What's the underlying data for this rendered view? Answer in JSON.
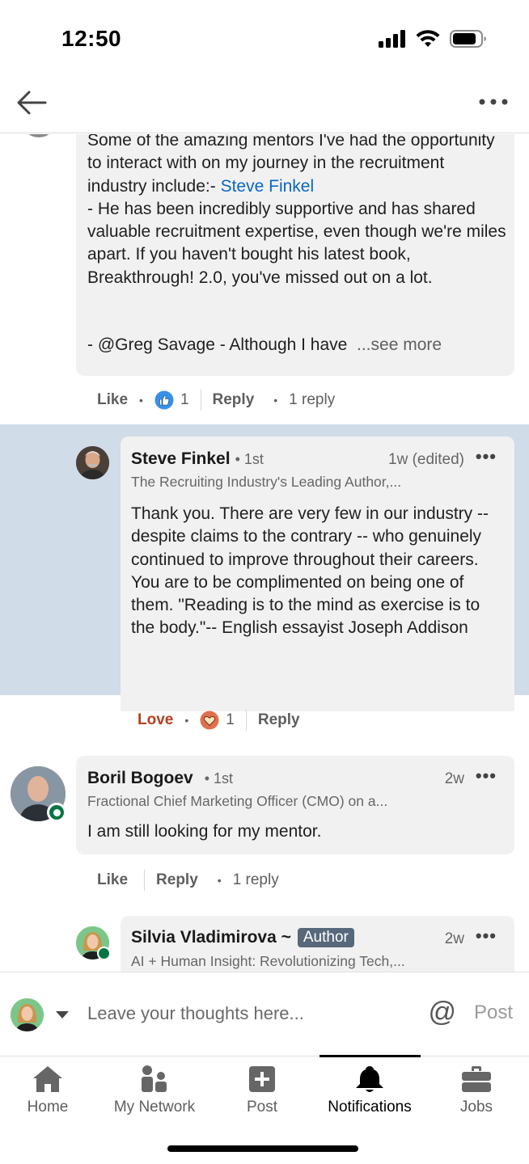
{
  "status": {
    "time": "12:50"
  },
  "comment1": {
    "text_before_link": "Some of the amazing mentors I've had the opportunity to interact with on my journey in the recruitment industry include:- ",
    "link": "Steve Finkel",
    "text_after_link": "\n- He has been incredibly supportive and has shared valuable recruitment expertise, even though we're miles apart. If you haven't bought his latest book, Breakthrough! 2.0, you've missed out on a lot.",
    "last_line": "- @Greg Savage - Although I have",
    "see_more": "...see more",
    "actions": {
      "like": "Like",
      "reaction_count": "1",
      "reply": "Reply",
      "replies": "1 reply"
    }
  },
  "reply1": {
    "name": "Steve Finkel",
    "degree": "• 1st",
    "time": "1w (edited)",
    "headline": "The Recruiting Industry's Leading Author,...",
    "text": "Thank you. There are very few in our industry -- despite claims to the contrary -- who genuinely continued to improve throughout their careers. You are to be complimented on being one of them. \"Reading is to the mind as exercise is to the body.\"-- English essayist Joseph Addison",
    "actions": {
      "love": "Love",
      "reaction_count": "1",
      "reply": "Reply"
    }
  },
  "comment2": {
    "name": "Boril Bogoev",
    "degree": "• 1st",
    "time": "2w",
    "headline": "Fractional Chief Marketing Officer (CMO) on a...",
    "text": "I am still looking for my mentor.",
    "actions": {
      "like": "Like",
      "reply": "Reply",
      "replies": "1 reply"
    }
  },
  "reply2": {
    "name": "Silvia Vladimirova ~",
    "badge": "Author",
    "time": "2w",
    "headline": "AI + Human Insight: Revolutionizing Tech,..."
  },
  "composer": {
    "placeholder": "Leave your thoughts here...",
    "mention_symbol": "@",
    "post_label": "Post"
  },
  "nav": [
    {
      "label": "Home",
      "icon": "home-icon"
    },
    {
      "label": "My Network",
      "icon": "network-icon"
    },
    {
      "label": "Post",
      "icon": "post-icon"
    },
    {
      "label": "Notifications",
      "icon": "bell-icon",
      "active": true
    },
    {
      "label": "Jobs",
      "icon": "briefcase-icon"
    }
  ],
  "colors": {
    "link": "#0a66c2",
    "love": "#b24020",
    "like": "#378fe9",
    "online": "#057642",
    "highlight": "#d0dce8",
    "author_badge": "#56687a"
  }
}
